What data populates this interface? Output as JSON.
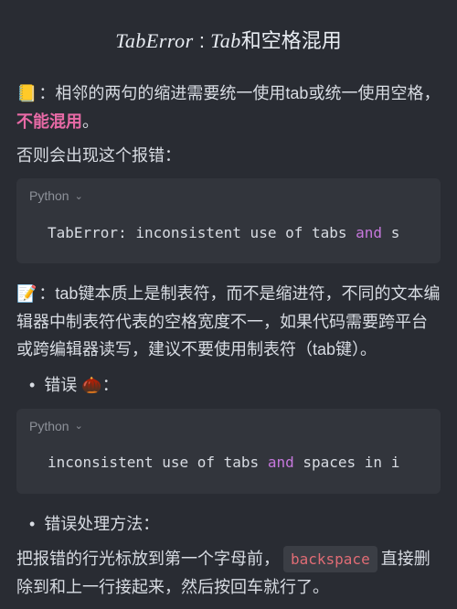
{
  "title": {
    "italic1": "TabError",
    "sep": " : ",
    "italic2": "Tab",
    "tail": "和空格混用"
  },
  "p1": {
    "emoji": "📒",
    "pre": "：相邻的两句的缩进需要统一使用tab或统一使用空格，",
    "pink": "不能混用",
    "post": "。"
  },
  "p2": "否则会出现这个报错：",
  "code1": {
    "lang": "Python",
    "pre": "TabError: inconsistent use of tabs ",
    "kw": "and",
    "post": " s"
  },
  "p3": {
    "emoji": "📝",
    "text": "：tab键本质上是制表符，而不是缩进符，不同的文本编辑器中制表符代表的空格宽度不一，如果代码需要跨平台或跨编辑器读写，建议不要使用制表符（tab键）。"
  },
  "bul1": {
    "label": "错误 ",
    "emoji": "🌰",
    "post": "："
  },
  "code2": {
    "lang": "Python",
    "pre": "inconsistent use of tabs ",
    "kw": "and",
    "post": " spaces in i"
  },
  "bul2": "错误处理方法：",
  "p4": {
    "pre": "把报错的行光标放到第一个字母前，",
    "code": "backspace",
    "post": "直接删除到和上一行接起来，然后按回车就行了。"
  }
}
